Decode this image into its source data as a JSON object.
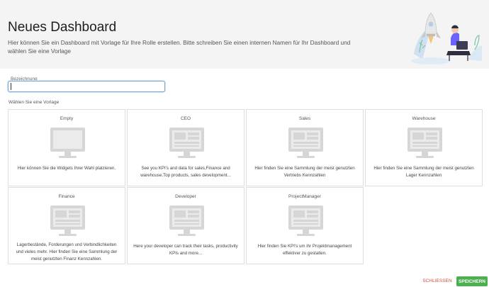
{
  "header": {
    "title": "Neues Dashboard",
    "subtitle": "Hier können Sie ein Dashboard mit Vorlage für Ihre Rolle erstellen. Bitte schreiben Sie einen internen Namen für Ihr Dashboard und wählen Sie eine Vorlage"
  },
  "form": {
    "name_label": "Bezeichnung",
    "name_value": ""
  },
  "templates": {
    "section_label": "Wählen Sie eine Vorlage",
    "items": [
      {
        "title": "Empty",
        "description": "Hier können Sie die Widgets Ihrer Wahl platzieren."
      },
      {
        "title": "CEO",
        "description": "See you KPI's and data for sales,Finance and warehouse.Top products, sales development..."
      },
      {
        "title": "Sales",
        "description": "Hier finden Sie eine Sammlung der meist genutzten Vertriebs Kennzahlen"
      },
      {
        "title": "Warehouse",
        "description": "Hier finden Sie eine Sammlung der meist genutzten Lager Kennzahlen"
      },
      {
        "title": "Finance",
        "description": "Lagerbestände, Forderungen und Verbindlichkeiten und vieles mehr. Hier finden Sie eine Sammlung der meist genutzten Finanz Kennzahlen."
      },
      {
        "title": "Developer",
        "description": "Here your developer can track their tasks, productivity KPIs and more..."
      },
      {
        "title": "ProjectManager",
        "description": "Hier finden Sie KPI's um ihr Projektmanagement effektiver zu gestalten."
      }
    ]
  },
  "footer": {
    "close_label": "SCHLIESSEN",
    "save_label": "SPEICHERN"
  },
  "colors": {
    "accent_save": "#4caf50",
    "accent_close": "#d0503c",
    "header_bg": "#f4f4f4",
    "icon_gray": "#d6d6d6"
  }
}
